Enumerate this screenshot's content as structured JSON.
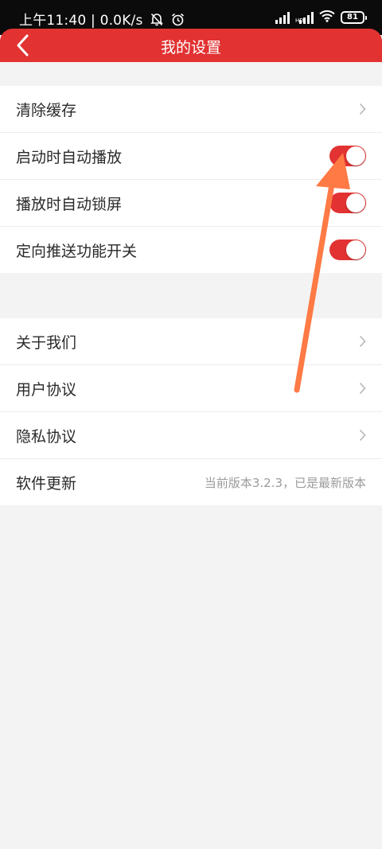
{
  "status_bar": {
    "time": "上午11:40",
    "network_speed": "0.0K/s",
    "separator": "|",
    "signal_label": "HD",
    "battery": "81"
  },
  "app_bar": {
    "title": "我的设置",
    "back_icon": "chevron-left-icon"
  },
  "settings_group_1": [
    {
      "label": "清除缓存",
      "control": "chevron"
    },
    {
      "label": "启动时自动播放",
      "control": "toggle",
      "on": true
    },
    {
      "label": "播放时自动锁屏",
      "control": "toggle",
      "on": true
    },
    {
      "label": "定向推送功能开关",
      "control": "toggle",
      "on": true
    }
  ],
  "settings_group_2": [
    {
      "label": "关于我们",
      "control": "chevron"
    },
    {
      "label": "用户协议",
      "control": "chevron"
    },
    {
      "label": "隐私协议",
      "control": "chevron"
    },
    {
      "label": "软件更新",
      "control": "value",
      "value": "当前版本3.2.3，已是最新版本"
    }
  ],
  "colors": {
    "accent": "#e23232",
    "annotation_arrow": "#ff7a45",
    "background": "#f3f3f3",
    "status_bar": "#0b0b0b"
  }
}
